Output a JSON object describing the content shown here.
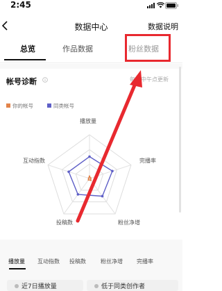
{
  "status_bar": {
    "time": "2:45"
  },
  "nav": {
    "title": "数据中心",
    "action": "数据说明"
  },
  "tabs": [
    {
      "label": "总览",
      "selected": true
    },
    {
      "label": "作品数据",
      "selected": false
    },
    {
      "label": "粉丝数据",
      "selected": false
    }
  ],
  "diagnosis": {
    "title": "帐号诊断",
    "update_note": "每日中午点更新",
    "legend": [
      {
        "label": "你的帐号",
        "color": "#e2834a"
      },
      {
        "label": "同类帐号",
        "color": "#5e5fc7"
      }
    ],
    "radar": {
      "axes": [
        "播放量",
        "完播率",
        "粉丝净增",
        "投稿数",
        "互动指数"
      ],
      "series": [
        {
          "name": "你的帐号",
          "color": "#e2834a",
          "values": [
            0.05,
            0.03,
            0.05,
            0.04,
            0.02
          ]
        },
        {
          "name": "同类帐号",
          "color": "#5e5fc7",
          "values": [
            0.5,
            0.55,
            0.5,
            0.45,
            0.5
          ]
        }
      ]
    }
  },
  "metric_tabs": [
    "播放量",
    "互动指数",
    "投稿数",
    "粉丝净增",
    "完播率"
  ],
  "bottom_cards": [
    {
      "text": "近7日播放量"
    },
    {
      "text": "低于同类创作者"
    }
  ],
  "colors": {
    "accent": "#111111",
    "highlight": "#e8292f"
  }
}
